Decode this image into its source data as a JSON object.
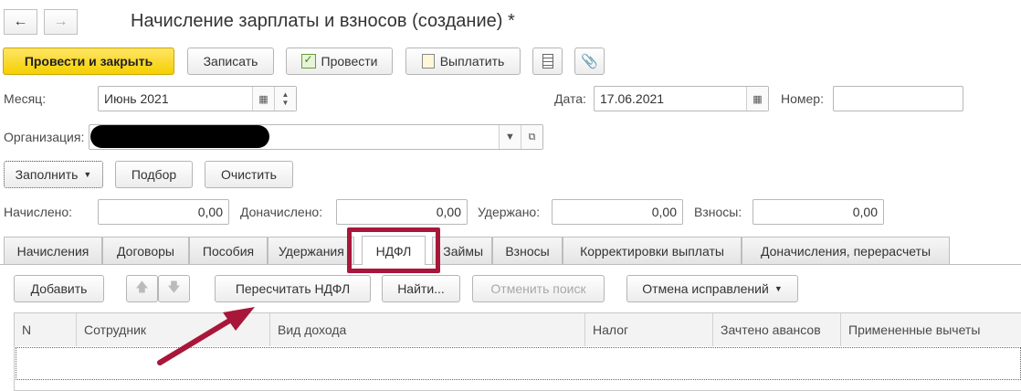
{
  "window": {
    "title": "Начисление зарплаты и взносов (создание) *"
  },
  "toolbar": {
    "post_close": "Провести и закрыть",
    "save": "Записать",
    "post": "Провести",
    "pay": "Выплатить"
  },
  "form": {
    "month_label": "Месяц:",
    "month_value": "Июнь 2021",
    "date_label": "Дата:",
    "date_value": "17.06.2021",
    "number_label": "Номер:",
    "number_value": "",
    "org_label": "Организация:",
    "org_value": ""
  },
  "actions": {
    "fill": "Заполнить",
    "select": "Подбор",
    "clear": "Очистить"
  },
  "totals": {
    "accrued_label": "Начислено:",
    "accrued_value": "0,00",
    "extra_label": "Доначислено:",
    "extra_value": "0,00",
    "withheld_label": "Удержано:",
    "withheld_value": "0,00",
    "contrib_label": "Взносы:",
    "contrib_value": "0,00"
  },
  "tabs": [
    {
      "label": "Начисления"
    },
    {
      "label": "Договоры"
    },
    {
      "label": "Пособия"
    },
    {
      "label": "Удержания"
    },
    {
      "label": "НДФЛ"
    },
    {
      "label": "Займы"
    },
    {
      "label": "Взносы"
    },
    {
      "label": "Корректировки выплаты"
    },
    {
      "label": "Доначисления, перерасчеты"
    }
  ],
  "tab_toolbar": {
    "add": "Добавить",
    "recalc": "Пересчитать НДФЛ",
    "find": "Найти...",
    "cancel_search": "Отменить поиск",
    "cancel_corrections": "Отмена исправлений"
  },
  "table": {
    "columns": [
      "N",
      "Сотрудник",
      "Вид дохода",
      "Налог",
      "Зачтено авансов",
      "Примененные вычеты"
    ]
  },
  "colors": {
    "highlight_box": "#a8173a",
    "arrow": "#a8173a",
    "primary_button": "#f5d000"
  }
}
